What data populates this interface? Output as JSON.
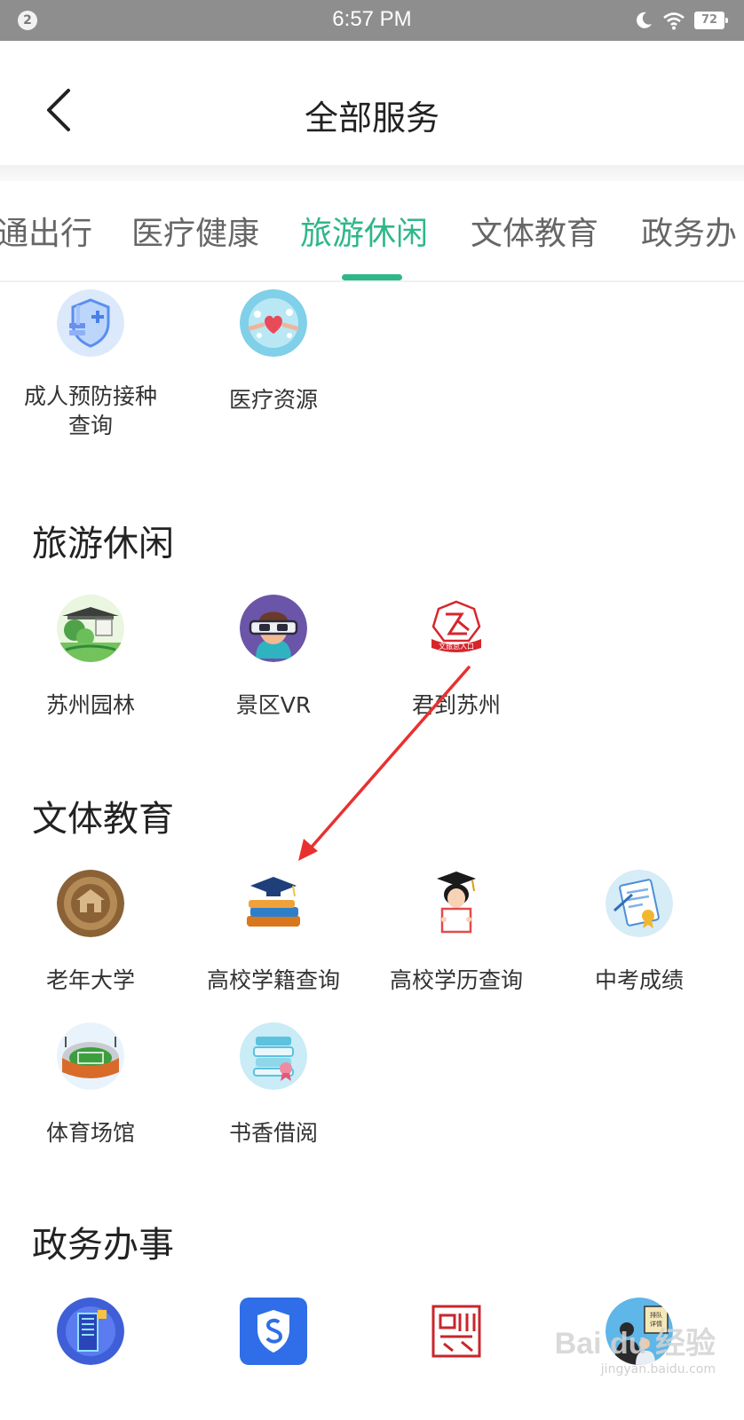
{
  "status_bar": {
    "notification_count": "2",
    "time": "6:57 PM",
    "battery": "72"
  },
  "header": {
    "title": "全部服务"
  },
  "tabs": [
    {
      "label": "通出行"
    },
    {
      "label": "医疗健康"
    },
    {
      "label": "旅游休闲",
      "active": true
    },
    {
      "label": "文体教育"
    },
    {
      "label": "政务办"
    }
  ],
  "medical_items": [
    {
      "label_line1": "成人预防接种",
      "label_line2": "查询",
      "icon": "vaccine-shield-icon"
    },
    {
      "label": "医疗资源",
      "icon": "medical-resource-icon"
    }
  ],
  "sections": {
    "travel": {
      "title": "旅游休闲",
      "items": [
        {
          "label": "苏州园林",
          "icon": "garden-icon"
        },
        {
          "label": "景区VR",
          "icon": "vr-headset-icon"
        },
        {
          "label": "君到苏州",
          "icon": "suzhou-tourism-logo-icon",
          "badge": "文旅总入口"
        }
      ]
    },
    "education": {
      "title": "文体教育",
      "items": [
        {
          "label": "老年大学",
          "icon": "senior-university-seal-icon"
        },
        {
          "label": "高校学籍查询",
          "icon": "graduation-books-icon"
        },
        {
          "label": "高校学历查询",
          "icon": "graduate-student-icon"
        },
        {
          "label": "中考成绩",
          "icon": "certificate-icon"
        },
        {
          "label": "体育场馆",
          "icon": "stadium-icon"
        },
        {
          "label": "书香借阅",
          "icon": "book-stack-icon"
        }
      ]
    },
    "government": {
      "title": "政务办事",
      "items": [
        {
          "icon": "building-icon"
        },
        {
          "icon": "shield-app-icon"
        },
        {
          "icon": "red-seal-icon"
        },
        {
          "icon": "queue-details-icon",
          "badge": "排队详情"
        }
      ]
    }
  },
  "watermark": {
    "brand": "Bai du 经验",
    "url": "jingyan.baidu.com"
  },
  "colors": {
    "accent": "#2fb78a",
    "status_bar": "#8e8e8e",
    "arrow": "#e8312f"
  }
}
